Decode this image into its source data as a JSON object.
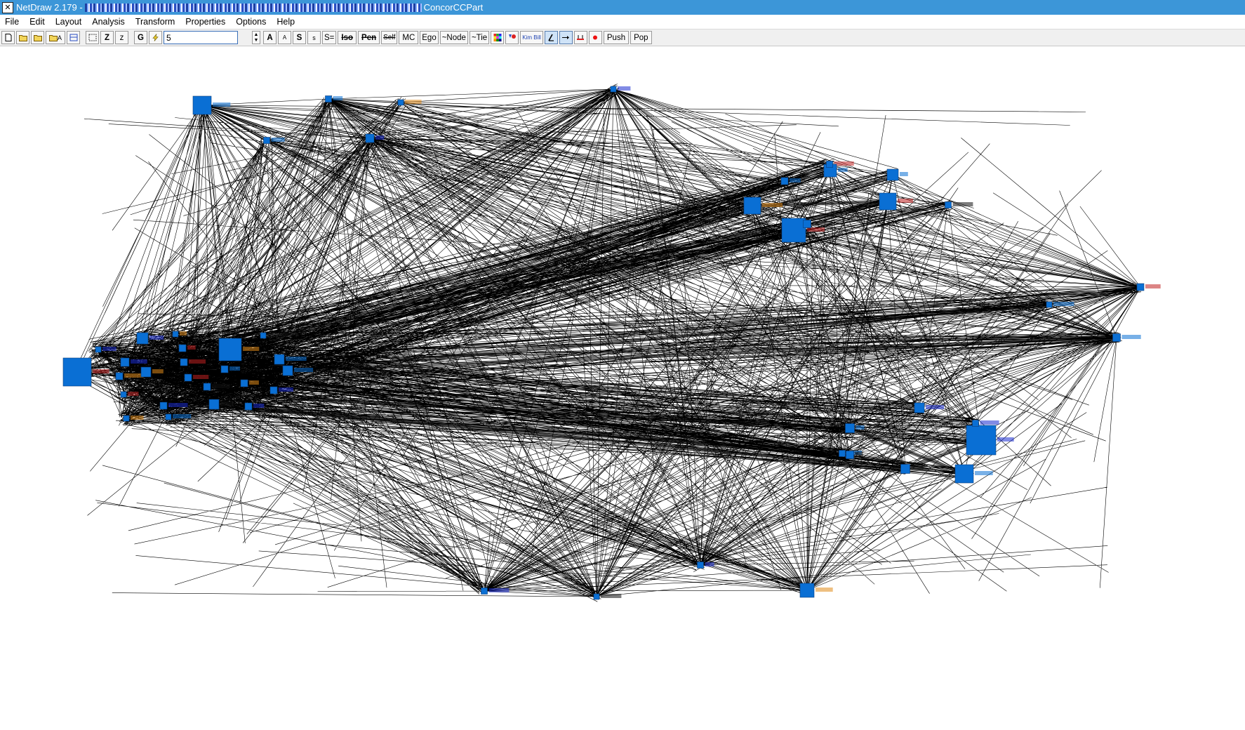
{
  "window": {
    "app_title": "NetDraw 2.179 -",
    "file_suffix": "ConcorCCPart"
  },
  "menu": {
    "items": [
      "File",
      "Edit",
      "Layout",
      "Analysis",
      "Transform",
      "Properties",
      "Options",
      "Help"
    ]
  },
  "toolbar": {
    "text_input_value": "5",
    "labels": {
      "z_big": "Z",
      "z_small": "z",
      "g": "G",
      "a_big": "A",
      "a_small": "A",
      "s_big": "S",
      "s_small": "s",
      "s_eq": "S=",
      "iso": "Iso",
      "pen": "Pen",
      "self": "Self",
      "mc": "MC",
      "ego": "Ego",
      "node": "~Node",
      "tie": "~Tie",
      "kim_bill": "Kim Bill",
      "push": "Push",
      "pop": "Pop"
    }
  },
  "network": {
    "node_color": "#0a6fd4",
    "edge_color": "#000000",
    "background": "#ffffff"
  }
}
